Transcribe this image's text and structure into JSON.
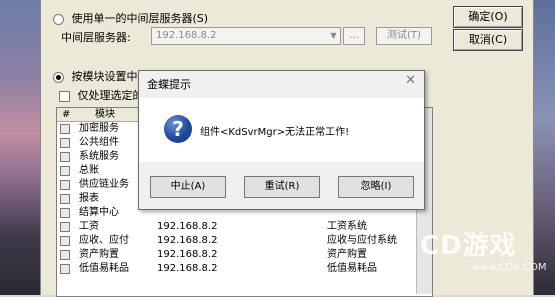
{
  "options": {
    "single_server_label": "使用单一的中间层服务器(S)",
    "server_label": "中间层服务器:",
    "server_value": "192.168.8.2",
    "browse_label": "...",
    "test_label": "测试(T)",
    "per_module_label": "按模块设置中间层服务器(M)",
    "only_selected_label": "仅处理选定的模块"
  },
  "buttons": {
    "ok": "确定(O)",
    "cancel": "取消(C)"
  },
  "table": {
    "headers": [
      "#",
      "模块"
    ],
    "rows": [
      {
        "name": "加密服务",
        "ip": "",
        "system": ""
      },
      {
        "name": "公共组件",
        "ip": "",
        "system": ""
      },
      {
        "name": "系统服务",
        "ip": "",
        "system": ""
      },
      {
        "name": "总账",
        "ip": "",
        "system": ""
      },
      {
        "name": "供应链业务",
        "ip": "",
        "system": ""
      },
      {
        "name": "报表",
        "ip": "",
        "system": ""
      },
      {
        "name": "结算中心",
        "ip": "",
        "system": ""
      },
      {
        "name": "工资",
        "ip": "192.168.8.2",
        "system": "工资系统"
      },
      {
        "name": "应收、应付",
        "ip": "192.168.8.2",
        "system": "应收与应付系统"
      },
      {
        "name": "资产购置",
        "ip": "192.168.8.2",
        "system": "资产购置"
      },
      {
        "name": "低值易耗品",
        "ip": "192.168.8.2",
        "system": "低值易耗品"
      }
    ]
  },
  "modal": {
    "title": "金蝶提示",
    "message": "组件<KdSvrMgr>无法正常工作!",
    "abort": "中止(A)",
    "retry": "重试(R)",
    "ignore": "忽略(I)"
  },
  "watermark": {
    "brand": "CD游戏",
    "url": "www.CD6.COM"
  }
}
